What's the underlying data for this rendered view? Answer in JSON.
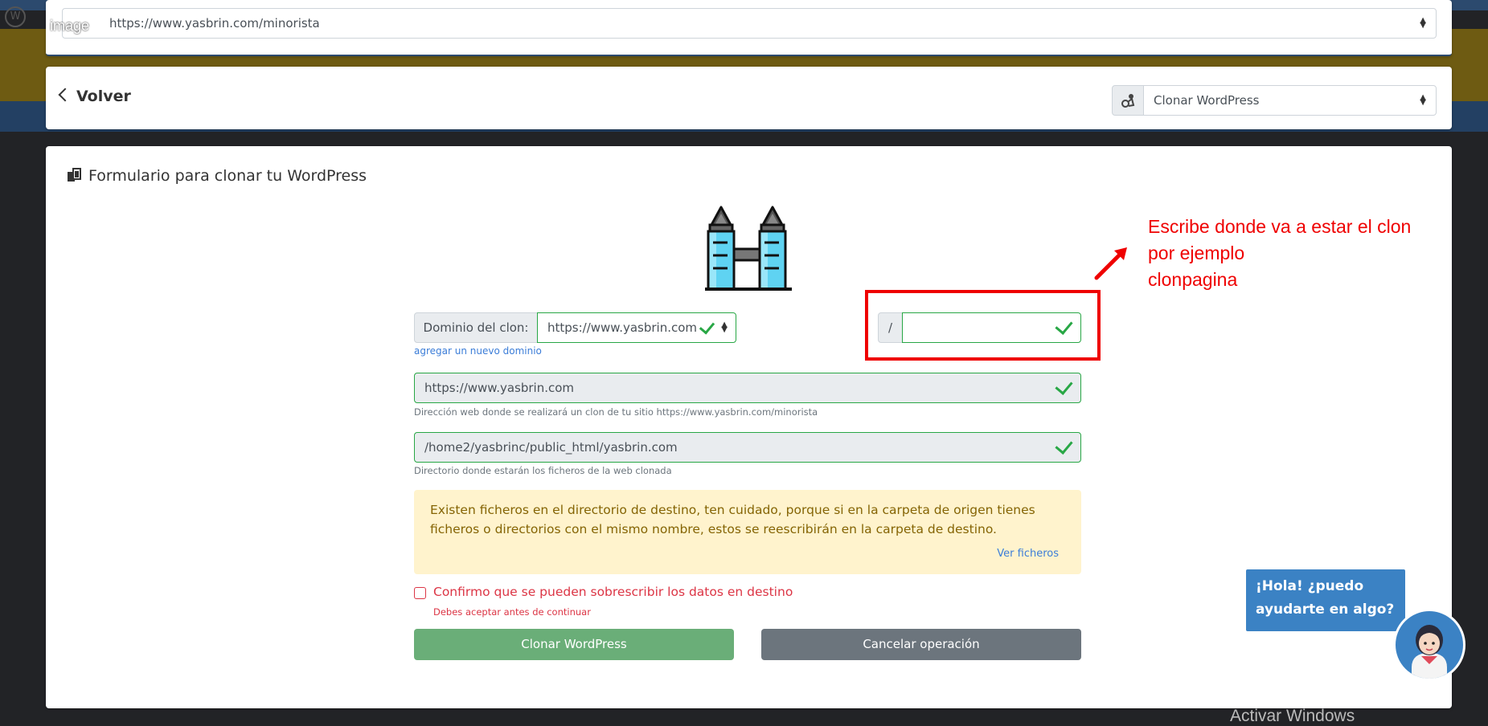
{
  "top": {
    "url_select_value": "https://www.yasbrin.com/minorista",
    "image_label": "image"
  },
  "nav": {
    "back_label": "Volver",
    "action_select_value": "Clonar WordPress"
  },
  "form": {
    "title": "Formulario para clonar tu WordPress",
    "domain_label": "Dominio del clon:",
    "domain_value": "https://www.yasbrin.com",
    "path_separator": "/",
    "path_value": "",
    "add_domain_link": "agregar un nuevo dominio",
    "web_url_value": "https://www.yasbrin.com",
    "web_url_help": "Dirección web donde se realizará un clon de tu sitio https://www.yasbrin.com/minorista",
    "directory_value": "/home2/yasbrinc/public_html/yasbrin.com",
    "directory_help": "Directorio donde estarán los ficheros de la web clonada",
    "alert_text": "Existen ficheros en el directorio de destino, ten cuidado, porque si en la carpeta de origen tienes ficheros o directorios con el mismo nombre, estos se reescribirán en la carpeta de destino.",
    "alert_link": "Ver ficheros",
    "confirm_label": "Confirmo que se pueden sobrescribir los datos en destino",
    "confirm_error": "Debes aceptar antes de continuar",
    "clone_button": "Clonar WordPress",
    "cancel_button": "Cancelar operación"
  },
  "annotation": {
    "line1": "Escribe donde va a estar el clon",
    "line2": "por ejemplo",
    "line3": "clonpagina",
    "color": "#ef0000"
  },
  "chat": {
    "line1": "¡Hola! ¿puedo",
    "line2": "ayudarte en algo?"
  },
  "windows_watermark": "Activar Windows",
  "colors": {
    "success": "#28a745",
    "danger": "#dc3545",
    "clone_button": "#6aae78",
    "cancel_button": "#6c757d",
    "alert_bg": "#fff3cd",
    "chat": "#3b82c4"
  }
}
